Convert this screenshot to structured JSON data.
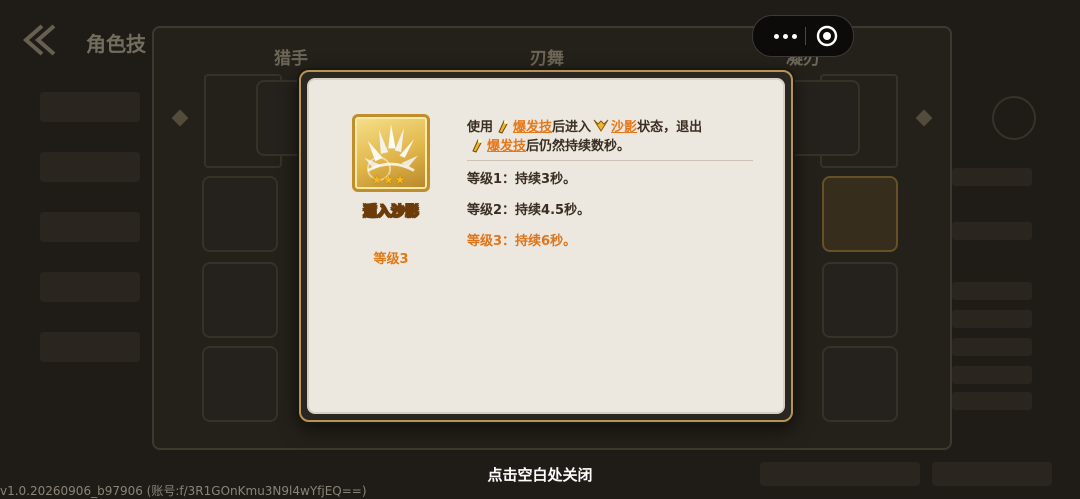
{
  "background": {
    "title": "角色技",
    "tabs": [
      "猎手",
      "刃舞",
      "凝刃"
    ]
  },
  "capsule": {
    "more_icon": "more-dots-icon",
    "close_icon": "target-circle-icon"
  },
  "skill": {
    "name": "遁入沙影",
    "level": "等级3",
    "stars": "★★★",
    "description": {
      "part1": "使用",
      "keyword1": "爆发技",
      "part2": "后进入",
      "keyword2": "沙影",
      "part3": "状态，退出",
      "keyword3": "爆发技",
      "part4": "后仍然持续数秒。"
    },
    "levels": [
      {
        "text": "等级1：持续3秒。",
        "active": false
      },
      {
        "text": "等级2：持续4.5秒。",
        "active": false
      },
      {
        "text": "等级3：持续6秒。",
        "active": true
      }
    ]
  },
  "close_hint": "点击空白处关闭",
  "version": "v1.0.20260906_b97906 (账号:f/3R1GOnKmu3N9l4wYfjEQ==)",
  "colors": {
    "accent_orange": "#e4781a",
    "gold": "#f1c24b",
    "panel_bg": "#ece7df"
  }
}
